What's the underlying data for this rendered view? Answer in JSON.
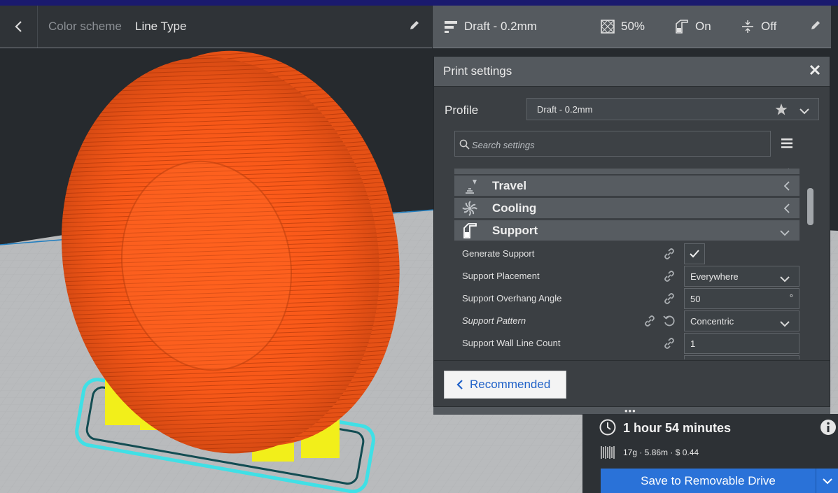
{
  "header": {
    "color_scheme_label": "Color scheme",
    "color_scheme_value": "Line Type",
    "profile_summary": "Draft - 0.2mm",
    "infill": "50%",
    "support": "On",
    "adhesion": "Off"
  },
  "print_settings": {
    "title": "Print settings",
    "profile_label": "Profile",
    "profile_value": "Draft - 0.2mm",
    "search_placeholder": "Search settings",
    "categories": [
      {
        "name": "Travel",
        "icon": "travel-icon"
      },
      {
        "name": "Cooling",
        "icon": "cooling-fan-icon"
      },
      {
        "name": "Support",
        "icon": "support-icon"
      }
    ],
    "settings": [
      {
        "label": "Generate Support",
        "value": "checked"
      },
      {
        "label": "Support Placement",
        "value": "Everywhere"
      },
      {
        "label": "Support Overhang Angle",
        "value": "50",
        "unit": "°"
      },
      {
        "label": "Support Pattern",
        "value": "Concentric"
      },
      {
        "label": "Support Wall Line Count",
        "value": "1"
      }
    ],
    "recommended_label": "Recommended"
  },
  "estimate": {
    "time": "1 hour 54 minutes",
    "material": "17g · 5.86m · $ 0.44",
    "save_label": "Save to Removable Drive"
  },
  "colors": {
    "model": "#ff5c1a",
    "support": "#f2ef1a",
    "skirt": "#3fe0e6",
    "accent": "#2a72d8",
    "panel": "#3b3f43"
  }
}
